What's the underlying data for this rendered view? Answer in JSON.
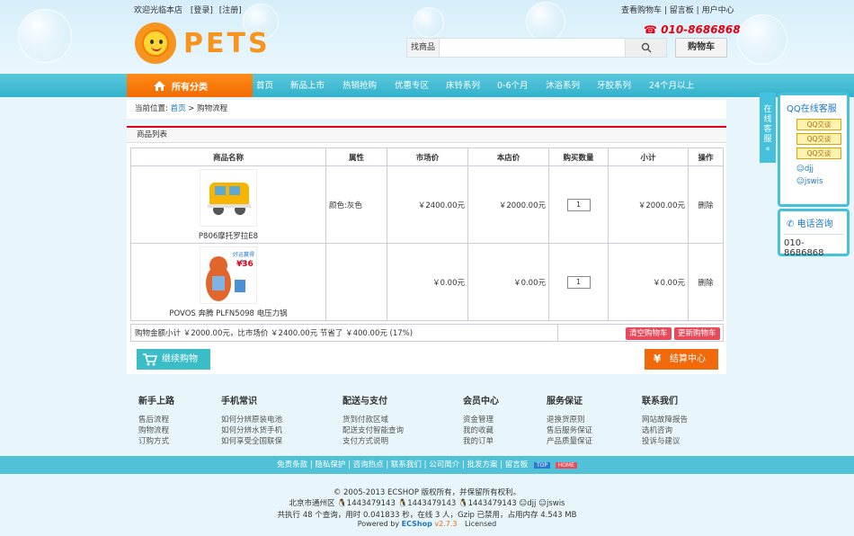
{
  "header": {
    "welcome": "欢迎光临本店",
    "login": "[登录]",
    "register": "[注册]",
    "top_links": [
      "查看购物车",
      "留言板",
      "用户中心"
    ],
    "phone": "010-8686868",
    "logo_text": "PETS",
    "search_label": "找商品",
    "search_value": "",
    "cart_button": "购物车"
  },
  "nav": {
    "all_categories": "所有分类",
    "items": [
      "首页",
      "新品上市",
      "热销抢购",
      "优惠专区",
      "床铃系列",
      "0-6个月",
      "沐浴系列",
      "牙胶系列",
      "24个月以上"
    ]
  },
  "breadcrumb": {
    "prefix": "当前位置:",
    "home": "首页",
    "sep": ">",
    "current": "购物流程"
  },
  "cart": {
    "section_title": "商品列表",
    "columns": [
      "商品名称",
      "属性",
      "市场价",
      "本店价",
      "购买数量",
      "小计",
      "操作"
    ],
    "rows": [
      {
        "name": "P806摩托罗拉E8",
        "attr": "颜色:灰色",
        "market": "￥2400.00元",
        "price": "￥2000.00元",
        "qty": "1",
        "subtotal": "￥2000.00元",
        "action": "删除"
      },
      {
        "name": "POVOS 奔腾 PLFN5098 电压力锅",
        "attr": "",
        "market": "￥0.00元",
        "price": "￥0.00元",
        "qty": "1",
        "subtotal": "￥0.00元",
        "action": "删除",
        "badge_top": "好运赢得制",
        "badge_price": "¥36"
      }
    ],
    "summary": "购物金额小计 ￥2000.00元，比市场价 ￥2400.00元 节省了 ￥400.00元 (17%)",
    "clear_button": "清空购物车",
    "update_button": "更新购物车",
    "continue_button": "继续购物",
    "checkout_button": "结算中心"
  },
  "help": [
    {
      "title": "新手上路",
      "items": [
        "售后流程",
        "购物流程",
        "订购方式"
      ]
    },
    {
      "title": "手机常识",
      "items": [
        "如何分辨原装电池",
        "如何分辨水货手机",
        "如何享受全国联保"
      ]
    },
    {
      "title": "配送与支付",
      "items": [
        "货到付款区域",
        "配送支付智能查询",
        "支付方式说明"
      ]
    },
    {
      "title": "会员中心",
      "items": [
        "资金管理",
        "我的收藏",
        "我的订单"
      ]
    },
    {
      "title": "服务保证",
      "items": [
        "退换货原则",
        "售后服务保证",
        "产品质量保证"
      ]
    },
    {
      "title": "联系我们",
      "items": [
        "网站故障报告",
        "选机咨询",
        "投诉与建议"
      ]
    }
  ],
  "footer": {
    "links": "免责条款 | 隐私保护 | 咨询热点 | 联系我们 | 公司简介 | 批发方案 | 留言板",
    "top_badge": "TOP",
    "home_badge": "HOME",
    "copyright": "© 2005-2013 ECSHOP 版权所有，并保留所有权利。",
    "address": "北京市通州区",
    "qq": [
      "1443479143",
      "1443479143",
      "1443479143"
    ],
    "ww": [
      "djj",
      "jswis"
    ],
    "stats": "共执行 48 个查询，用时 0.041833 秒，在线 3 人，Gzip 已禁用，占用内存 4.543 MB",
    "powered_prefix": "Powered by",
    "powered_brand": "ECShop",
    "version": "v2.7.3",
    "licensed": "Licensed"
  },
  "service": {
    "tab_label": "在线客服",
    "qq_title": "QQ在线客服",
    "qq_buttons": [
      "QQ交谈",
      "QQ交谈",
      "QQ交谈"
    ],
    "ww_names": [
      "djj",
      "jswis"
    ],
    "tel_title": "电话咨询",
    "tel_number": "010-8686868"
  }
}
